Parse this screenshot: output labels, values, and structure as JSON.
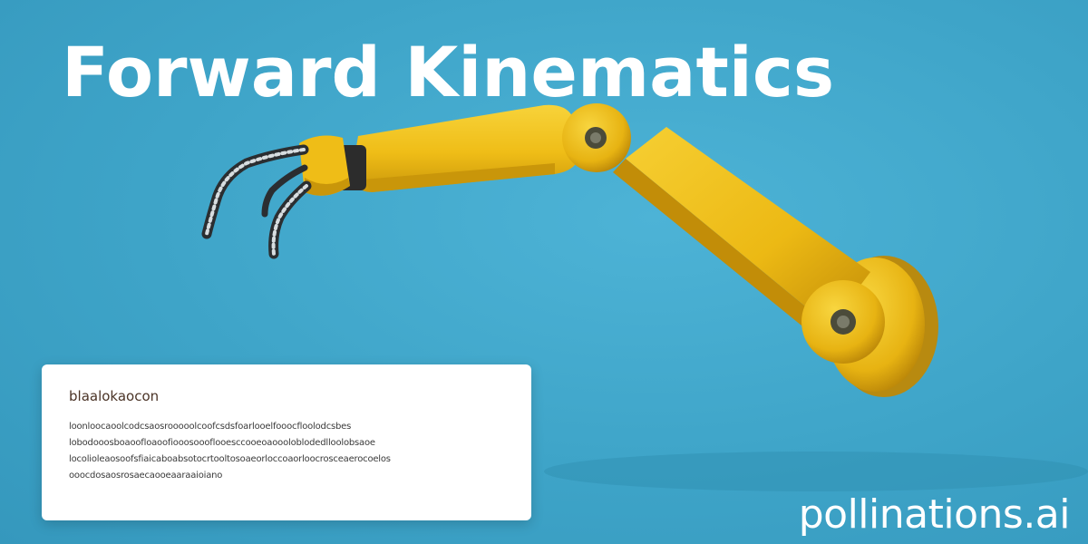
{
  "title": "Forward Kinematics",
  "card": {
    "heading": "blaalokaocon",
    "lines": [
      "loonloocaoolcodcsaosrooooolcoofcsdsfoarlooelfooocfloolodcsbes",
      "lobodooosboaoofloaoofiooosoooflooesccooeoaoooloblodedlloolobsaoe",
      "locolioleaosoofsfiaicaboabsotocrtooltosoaeorloccoaorloocrosceaerocoelos",
      "ooocdosaosrosaecaooeaaraaioiano"
    ]
  },
  "watermark": "pollinations.ai",
  "colors": {
    "background": "#3fa6c9",
    "arm_yellow": "#f2c21a",
    "arm_shadow": "#c9960a",
    "card": "#ffffff",
    "title": "#ffffff"
  }
}
